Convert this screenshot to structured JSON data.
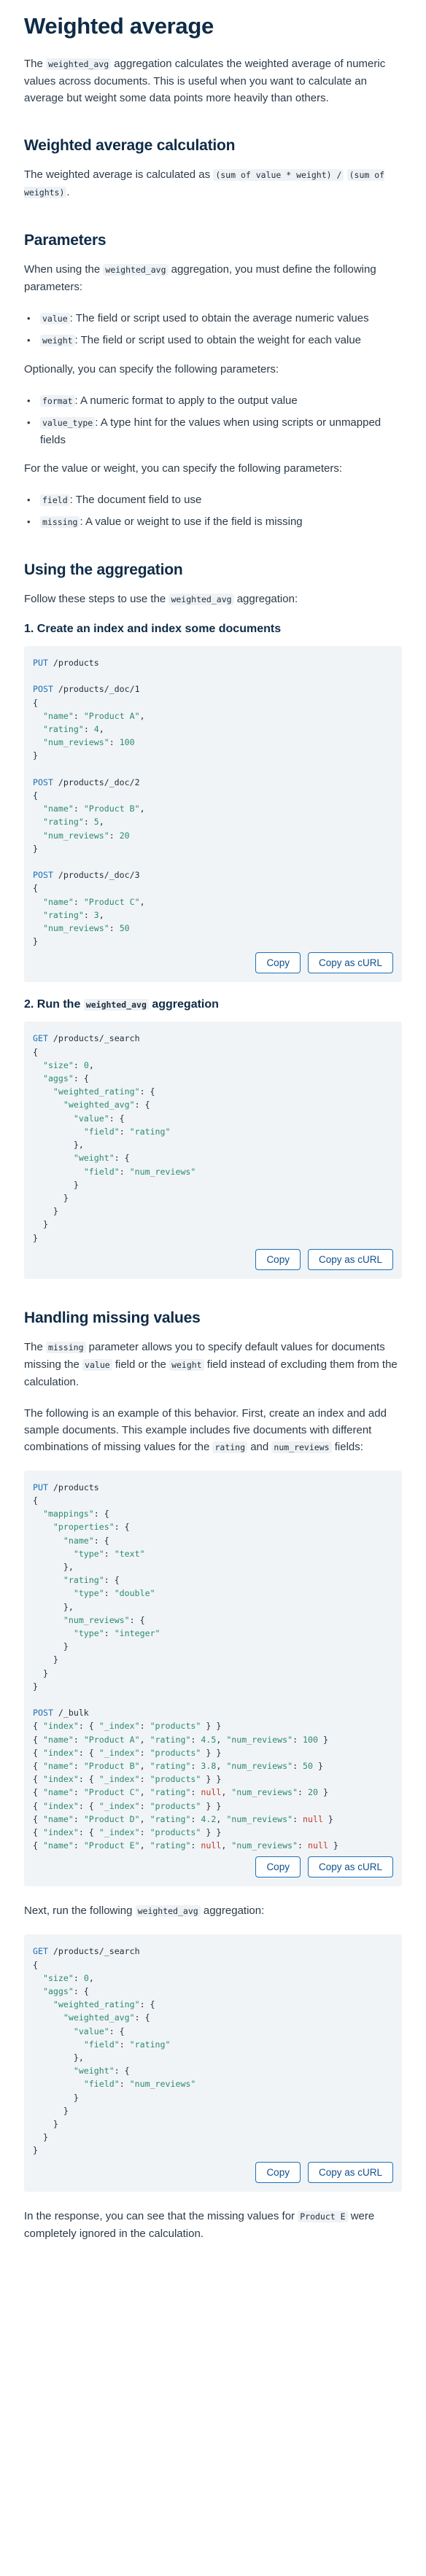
{
  "title": "Weighted average",
  "intro": {
    "p1": "The",
    "code": "weighted_avg",
    "p2": "aggregation calculates the weighted average of numeric values across documents. This is useful when you want to calculate an average but weight some data points more heavily than others."
  },
  "calc": {
    "heading": "Weighted average calculation",
    "p1": "The weighted average is calculated as",
    "code1": "(sum of value * weight) /",
    "code2": "(sum of weights)",
    "p2": "."
  },
  "params": {
    "heading": "Parameters",
    "lead1": "When using the",
    "lead_code": "weighted_avg",
    "lead2": "aggregation, you must define the following parameters:",
    "required": [
      {
        "code": "value",
        "text": ": The field or script used to obtain the average numeric values"
      },
      {
        "code": "weight",
        "text": ": The field or script used to obtain the weight for each value"
      }
    ],
    "optional_lead": "Optionally, you can specify the following parameters:",
    "optional": [
      {
        "code": "format",
        "text": ": A numeric format to apply to the output value"
      },
      {
        "code": "value_type",
        "text": ": A type hint for the values when using scripts or unmapped fields"
      }
    ],
    "vw_lead": "For the value or weight, you can specify the following parameters:",
    "vw": [
      {
        "code": "field",
        "text": ": The document field to use"
      },
      {
        "code": "missing",
        "text": ": A value or weight to use if the field is missing"
      }
    ]
  },
  "usage": {
    "heading": "Using the aggregation",
    "lead1": "Follow these steps to use the",
    "lead_code": "weighted_avg",
    "lead2": "aggregation:",
    "step1": "1. Create an index and index some documents",
    "step2a": "2. Run the",
    "step2_code": "weighted_avg",
    "step2b": "aggregation"
  },
  "missing": {
    "heading": "Handling missing values",
    "p1a": "The",
    "p1_code1": "missing",
    "p1b": "parameter allows you to specify default values for documents missing the",
    "p1_code2": "value",
    "p1c": "field or the",
    "p1_code3": "weight",
    "p1d": "field instead of excluding them from the calculation.",
    "p2a": "The following is an example of this behavior. First, create an index and add sample documents. This example includes five documents with different combinations of missing values for the",
    "p2_code1": "rating",
    "p2b": "and",
    "p2_code2": "num_reviews",
    "p2c": "fields:",
    "p3a": "Next, run the following",
    "p3_code": "weighted_avg",
    "p3b": "aggregation:",
    "p4a": "In the response, you can see that the missing values for",
    "p4_code": "Product E",
    "p4b": "were completely ignored in the calculation."
  },
  "buttons": {
    "copy": "Copy",
    "copy_curl": "Copy as cURL"
  }
}
